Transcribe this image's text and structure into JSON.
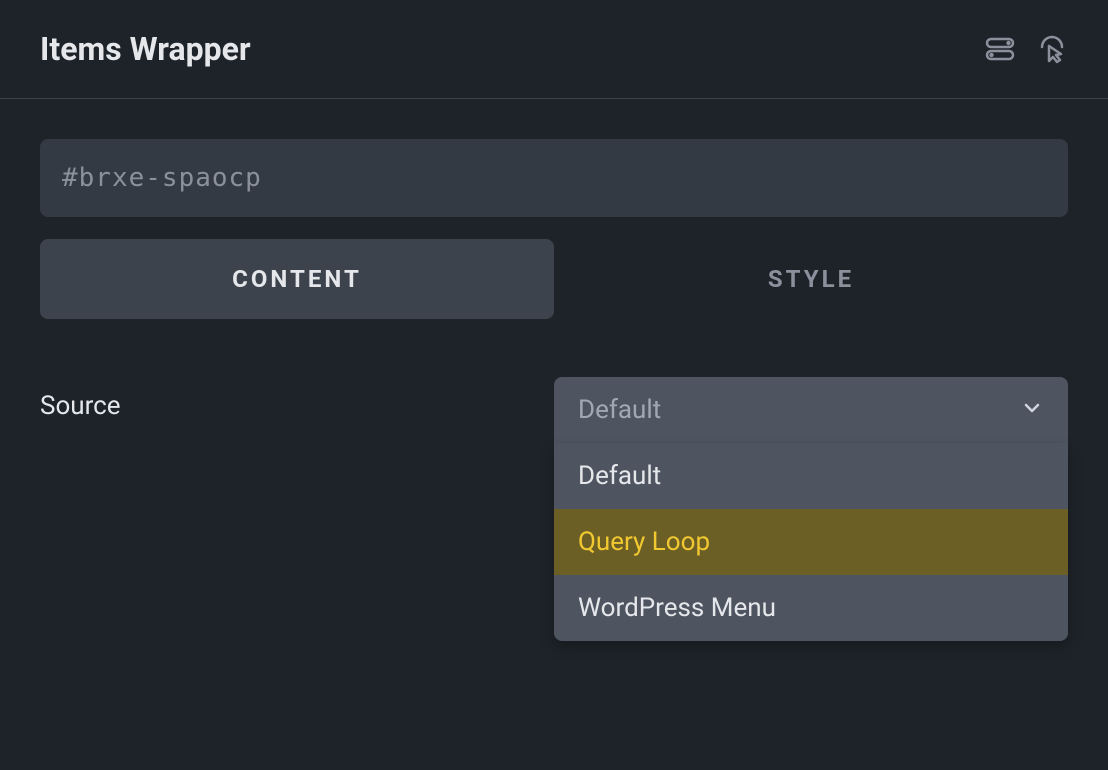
{
  "header": {
    "title": "Items Wrapper"
  },
  "id_field": {
    "value": "#brxe-spaocp"
  },
  "tabs": {
    "content": "CONTENT",
    "style": "STYLE",
    "active": "content"
  },
  "source": {
    "label": "Source",
    "selected": "Default",
    "options": [
      "Default",
      "Query Loop",
      "WordPress Menu"
    ],
    "highlighted_index": 1
  },
  "icons": {
    "toggle": "toggle-icon",
    "interactions": "interactions-icon",
    "chevron": "chevron-down-icon"
  }
}
